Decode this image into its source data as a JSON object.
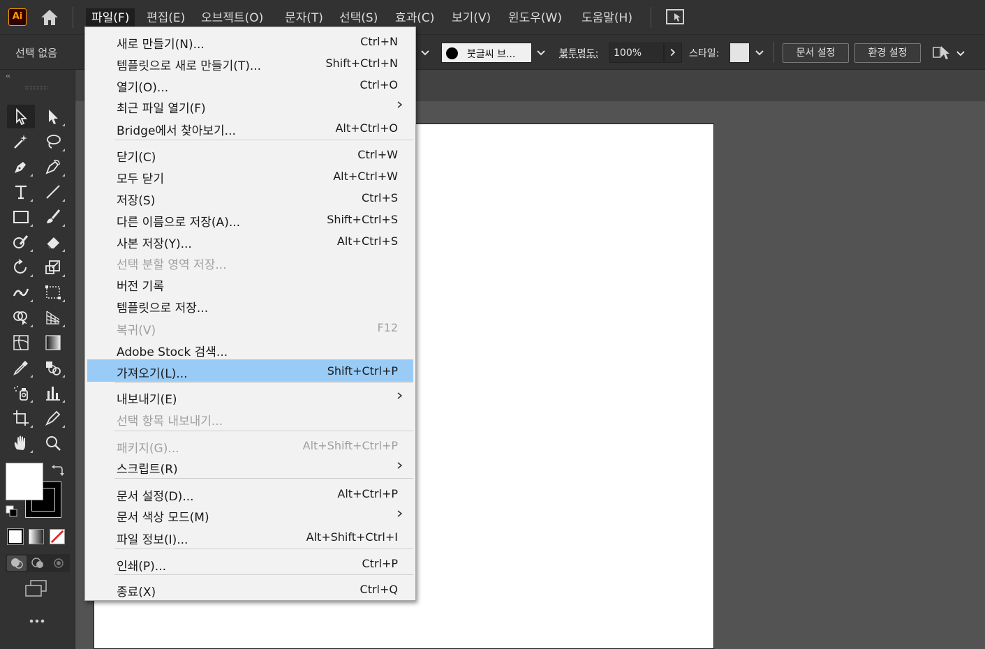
{
  "app": {
    "logo_text": "Ai"
  },
  "menubar": {
    "items": [
      "파일(F)",
      "편집(E)",
      "오브젝트(O)",
      "문자(T)",
      "선택(S)",
      "효과(C)",
      "보기(V)",
      "윈도우(W)",
      "도움말(H)"
    ],
    "active": "파일(F)"
  },
  "controlbar": {
    "selection_status": "선택 없음",
    "brush_label": "붓글씨 브...",
    "opacity_label": "불투명도:",
    "opacity_value": "100%",
    "style_label": "스타일:",
    "document_setup_button": "문서 설정",
    "preferences_button": "환경 설정"
  },
  "toolbar": {
    "collapse_glyph": "‹‹"
  },
  "file_menu": {
    "items": [
      {
        "label": "새로 만들기(N)...",
        "shortcut": "Ctrl+N"
      },
      {
        "label": "템플릿으로 새로 만들기(T)...",
        "shortcut": "Shift+Ctrl+N"
      },
      {
        "label": "열기(O)...",
        "shortcut": "Ctrl+O"
      },
      {
        "label": "최근 파일 열기(F)",
        "shortcut": ""
      },
      {
        "label": "Bridge에서 찾아보기...",
        "shortcut": "Alt+Ctrl+O"
      },
      {
        "label": "닫기(C)",
        "shortcut": "Ctrl+W"
      },
      {
        "label": "모두 닫기",
        "shortcut": "Alt+Ctrl+W"
      },
      {
        "label": "저장(S)",
        "shortcut": "Ctrl+S"
      },
      {
        "label": "다른 이름으로 저장(A)...",
        "shortcut": "Shift+Ctrl+S"
      },
      {
        "label": "사본 저장(Y)...",
        "shortcut": "Alt+Ctrl+S"
      },
      {
        "label": "선택 분할 영역 저장...",
        "shortcut": ""
      },
      {
        "label": "버전 기록",
        "shortcut": ""
      },
      {
        "label": "템플릿으로 저장...",
        "shortcut": ""
      },
      {
        "label": "복귀(V)",
        "shortcut": "F12"
      },
      {
        "label": "Adobe Stock 검색...",
        "shortcut": ""
      },
      {
        "label": "가져오기(L)...",
        "shortcut": "Shift+Ctrl+P"
      },
      {
        "label": "내보내기(E)",
        "shortcut": ""
      },
      {
        "label": "선택 항목 내보내기...",
        "shortcut": ""
      },
      {
        "label": "패키지(G)...",
        "shortcut": "Alt+Shift+Ctrl+P"
      },
      {
        "label": "스크립트(R)",
        "shortcut": ""
      },
      {
        "label": "문서 설정(D)...",
        "shortcut": "Alt+Ctrl+P"
      },
      {
        "label": "문서 색상 모드(M)",
        "shortcut": ""
      },
      {
        "label": "파일 정보(I)...",
        "shortcut": "Alt+Shift+Ctrl+I"
      },
      {
        "label": "인쇄(P)...",
        "shortcut": "Ctrl+P"
      },
      {
        "label": "종료(X)",
        "shortcut": "Ctrl+Q"
      }
    ],
    "highlighted": "가져오기(L)...",
    "disabled": [
      "선택 분할 영역 저장...",
      "복귀(V)",
      "선택 항목 내보내기...",
      "패키지(G)..."
    ],
    "submenu_items": [
      "최근 파일 열기(F)",
      "내보내기(E)",
      "스크립트(R)",
      "문서 색상 모드(M)"
    ]
  },
  "colors": {
    "highlight": "#99cbf7",
    "logo_accent": "#ff9a00",
    "logo_bg": "#330000",
    "none_swatch_red": "#e02020"
  }
}
